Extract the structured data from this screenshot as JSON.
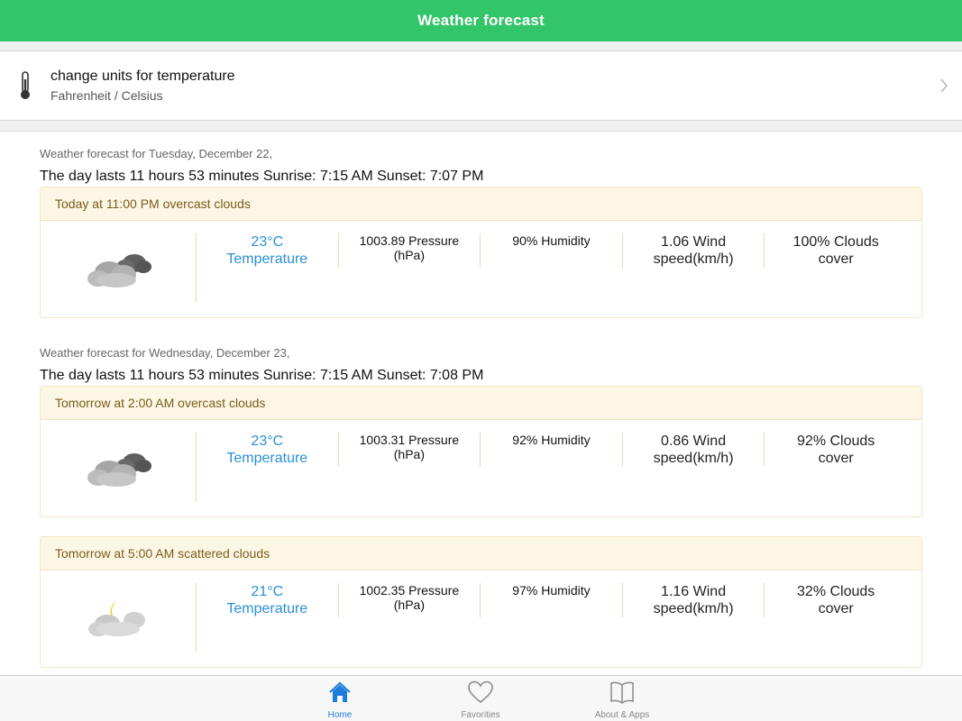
{
  "navbar": {
    "title": "Weather forecast"
  },
  "units": {
    "title": "change units for temperature",
    "subtitle": "Fahrenheit / Celsius",
    "icon": "thermometer-icon",
    "chevron_icon": "chevron-right-icon"
  },
  "days": [
    {
      "header": "Weather forecast for Tuesday, December 22,",
      "summary": "The day lasts 11 hours 53 minutes Sunrise: 7:15 AM Sunset: 7:07 PM"
    },
    {
      "header": "Weather forecast for Wednesday, December 23,",
      "summary": "The day lasts 11 hours 53 minutes Sunrise: 7:15 AM Sunset: 7:08 PM"
    }
  ],
  "forecasts": [
    {
      "title": "Today at 11:00 PM overcast clouds",
      "icon": "overcast-clouds-icon",
      "temp_value": "23°C",
      "temp_label": "Temperature",
      "pressure_line1": "1003.89 Pressure",
      "pressure_line2": "(hPa)",
      "humidity": "90% Humidity",
      "wind_line1": "1.06 Wind",
      "wind_line2": "speed(km/h)",
      "clouds_line1": "100% Clouds",
      "clouds_line2": "cover"
    },
    {
      "title": "Tomorrow at 2:00 AM overcast clouds",
      "icon": "overcast-clouds-icon",
      "temp_value": "23°C",
      "temp_label": "Temperature",
      "pressure_line1": "1003.31 Pressure",
      "pressure_line2": "(hPa)",
      "humidity": "92% Humidity",
      "wind_line1": "0.86 Wind",
      "wind_line2": "speed(km/h)",
      "clouds_line1": "92% Clouds",
      "clouds_line2": "cover"
    },
    {
      "title": "Tomorrow at 5:00 AM scattered clouds",
      "icon": "scattered-clouds-night-icon",
      "temp_value": "21°C",
      "temp_label": "Temperature",
      "pressure_line1": "1002.35 Pressure",
      "pressure_line2": "(hPa)",
      "humidity": "97% Humidity",
      "wind_line1": "1.16 Wind",
      "wind_line2": "speed(km/h)",
      "clouds_line1": "32% Clouds",
      "clouds_line2": "cover"
    }
  ],
  "tabs": [
    {
      "label": "Home",
      "icon": "home-icon",
      "active": true
    },
    {
      "label": "Favorities",
      "icon": "heart-icon",
      "active": false
    },
    {
      "label": "About & Apps",
      "icon": "book-icon",
      "active": false
    }
  ],
  "colors": {
    "navbar": "#33c56a",
    "accent_blue": "#2a8fd6",
    "card_header_bg": "#fcf7e4",
    "card_header_text": "#7a5b1c",
    "active_tab": "#1d7ddb"
  }
}
